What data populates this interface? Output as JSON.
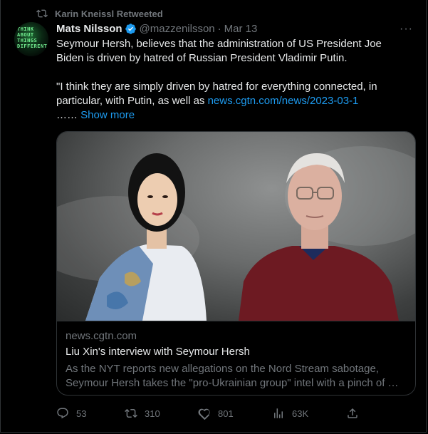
{
  "retweet_label": "Karin Kneissl Retweeted",
  "author": {
    "name": "Mats Nilsson",
    "handle": "@mazzenilsson",
    "date": "Mar 13",
    "avatar_text": "THINK ABOUT THINGS DIFFERENTLY"
  },
  "text": {
    "para1": "Seymour Hersh, believes that the administration of US President Joe Biden is driven by hatred of Russian President Vladimir Putin.",
    "para2_prefix": "\"I think they are simply driven by hatred for everything connected, in particular, with Putin, as well as ",
    "para2_link": "news.cgtn.com/news/2023-03-1",
    "para2_ellipsis": "……",
    "show_more": "Show more"
  },
  "card": {
    "domain": "news.cgtn.com",
    "title": "Liu Xin's interview with Seymour Hersh",
    "description": "As the NYT reports new allegations on the Nord Stream sabotage, Seymour Hersh takes the \"pro-Ukrainian group\" intel with a pinch of …"
  },
  "actions": {
    "replies": "53",
    "retweets": "310",
    "likes": "801",
    "views": "63K"
  },
  "colors": {
    "background": "#000000",
    "text": "#e7e9ea",
    "muted": "#71767b",
    "link": "#1d9bf0",
    "border": "#2f3336"
  }
}
